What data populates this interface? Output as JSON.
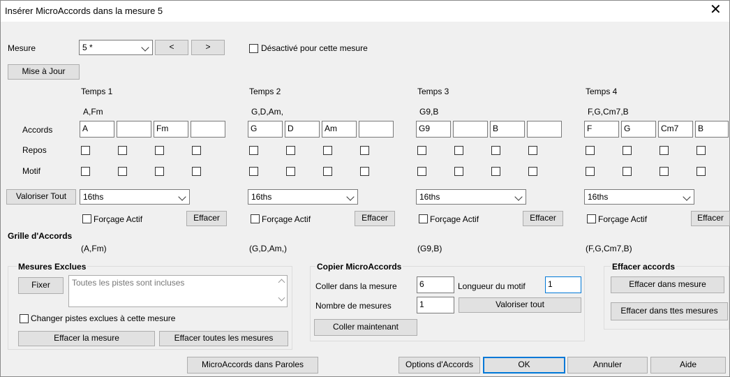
{
  "window": {
    "title": "Insérer MicroAccords dans la mesure 5",
    "close": "✕"
  },
  "mesure": {
    "label": "Mesure",
    "value": "5 *",
    "prev": "<",
    "next": ">",
    "disabled_label": "Désactivé pour cette mesure"
  },
  "update_button": "Mise à Jour",
  "row_labels": {
    "accords": "Accords",
    "repos": "Repos",
    "motif": "Motif"
  },
  "valoriser_tout_button": "Valoriser Tout",
  "beats": [
    {
      "label": "Temps 1",
      "summary": "A,Fm",
      "chords": [
        "A",
        "",
        "Fm",
        ""
      ],
      "rhythm": "16ths",
      "force_label": "Forçage Actif",
      "clear": "Effacer",
      "grid": "(A,Fm)"
    },
    {
      "label": "Temps 2",
      "summary": "G,D,Am,",
      "chords": [
        "G",
        "D",
        "Am",
        ""
      ],
      "rhythm": "16ths",
      "force_label": "Forçage Actif",
      "clear": "Effacer",
      "grid": "(G,D,Am,)"
    },
    {
      "label": "Temps 3",
      "summary": "G9,B",
      "chords": [
        "G9",
        "",
        "B",
        ""
      ],
      "rhythm": "16ths",
      "force_label": "Forçage Actif",
      "clear": "Effacer",
      "grid": "(G9,B)"
    },
    {
      "label": "Temps 4",
      "summary": "F,G,Cm7,B",
      "chords": [
        "F",
        "G",
        "Cm7",
        "B"
      ],
      "rhythm": "16ths",
      "force_label": "Forçage Actif",
      "clear": "Effacer",
      "grid": "(F,G,Cm7,B)"
    }
  ],
  "grille": {
    "title": "Grille d'Accords"
  },
  "mesures_exclues": {
    "title": "Mesures Exclues",
    "fix": "Fixer",
    "text": "Toutes les pistes sont incluses",
    "change_label": "Changer pistes exclues à cette mesure",
    "clear_measure": "Effacer la mesure",
    "clear_all": "Effacer toutes les mesures"
  },
  "copier": {
    "title": "Copier MicroAccords",
    "paste_label": "Coller dans la mesure",
    "paste_value": "6",
    "length_label": "Longueur du motif",
    "length_value": "1",
    "count_label": "Nombre de mesures",
    "count_value": "1",
    "valoriser": "Valoriser tout",
    "paste_now": "Coller maintenant"
  },
  "effacer_accords": {
    "title": "Effacer accords",
    "in_measure": "Effacer dans mesure",
    "in_all": "Effacer dans ttes mesures"
  },
  "bottom": {
    "lyrics": "MicroAccords dans Paroles",
    "options": "Options d'Accords",
    "ok": "OK",
    "cancel": "Annuler",
    "help": "Aide"
  }
}
